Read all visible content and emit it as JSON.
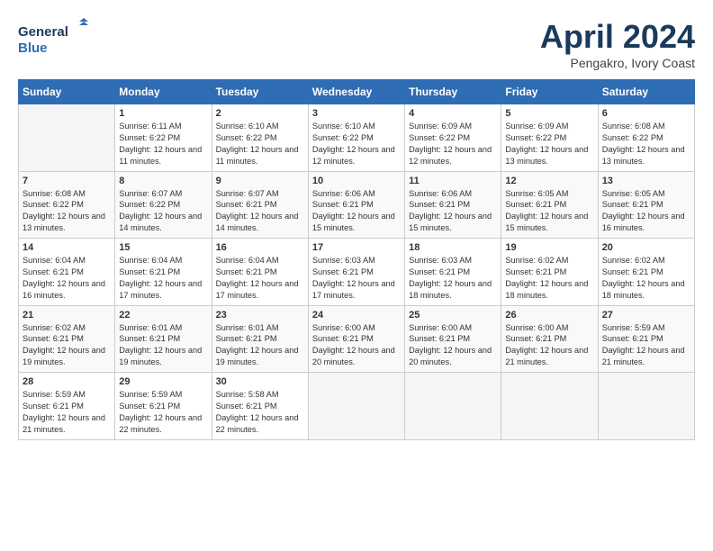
{
  "header": {
    "logo_line1": "General",
    "logo_line2": "Blue",
    "month": "April 2024",
    "location": "Pengakro, Ivory Coast"
  },
  "days_of_week": [
    "Sunday",
    "Monday",
    "Tuesday",
    "Wednesday",
    "Thursday",
    "Friday",
    "Saturday"
  ],
  "weeks": [
    [
      {
        "day": "",
        "sunrise": "",
        "sunset": "",
        "daylight": ""
      },
      {
        "day": "1",
        "sunrise": "Sunrise: 6:11 AM",
        "sunset": "Sunset: 6:22 PM",
        "daylight": "Daylight: 12 hours and 11 minutes."
      },
      {
        "day": "2",
        "sunrise": "Sunrise: 6:10 AM",
        "sunset": "Sunset: 6:22 PM",
        "daylight": "Daylight: 12 hours and 11 minutes."
      },
      {
        "day": "3",
        "sunrise": "Sunrise: 6:10 AM",
        "sunset": "Sunset: 6:22 PM",
        "daylight": "Daylight: 12 hours and 12 minutes."
      },
      {
        "day": "4",
        "sunrise": "Sunrise: 6:09 AM",
        "sunset": "Sunset: 6:22 PM",
        "daylight": "Daylight: 12 hours and 12 minutes."
      },
      {
        "day": "5",
        "sunrise": "Sunrise: 6:09 AM",
        "sunset": "Sunset: 6:22 PM",
        "daylight": "Daylight: 12 hours and 13 minutes."
      },
      {
        "day": "6",
        "sunrise": "Sunrise: 6:08 AM",
        "sunset": "Sunset: 6:22 PM",
        "daylight": "Daylight: 12 hours and 13 minutes."
      }
    ],
    [
      {
        "day": "7",
        "sunrise": "Sunrise: 6:08 AM",
        "sunset": "Sunset: 6:22 PM",
        "daylight": "Daylight: 12 hours and 13 minutes."
      },
      {
        "day": "8",
        "sunrise": "Sunrise: 6:07 AM",
        "sunset": "Sunset: 6:22 PM",
        "daylight": "Daylight: 12 hours and 14 minutes."
      },
      {
        "day": "9",
        "sunrise": "Sunrise: 6:07 AM",
        "sunset": "Sunset: 6:21 PM",
        "daylight": "Daylight: 12 hours and 14 minutes."
      },
      {
        "day": "10",
        "sunrise": "Sunrise: 6:06 AM",
        "sunset": "Sunset: 6:21 PM",
        "daylight": "Daylight: 12 hours and 15 minutes."
      },
      {
        "day": "11",
        "sunrise": "Sunrise: 6:06 AM",
        "sunset": "Sunset: 6:21 PM",
        "daylight": "Daylight: 12 hours and 15 minutes."
      },
      {
        "day": "12",
        "sunrise": "Sunrise: 6:05 AM",
        "sunset": "Sunset: 6:21 PM",
        "daylight": "Daylight: 12 hours and 15 minutes."
      },
      {
        "day": "13",
        "sunrise": "Sunrise: 6:05 AM",
        "sunset": "Sunset: 6:21 PM",
        "daylight": "Daylight: 12 hours and 16 minutes."
      }
    ],
    [
      {
        "day": "14",
        "sunrise": "Sunrise: 6:04 AM",
        "sunset": "Sunset: 6:21 PM",
        "daylight": "Daylight: 12 hours and 16 minutes."
      },
      {
        "day": "15",
        "sunrise": "Sunrise: 6:04 AM",
        "sunset": "Sunset: 6:21 PM",
        "daylight": "Daylight: 12 hours and 17 minutes."
      },
      {
        "day": "16",
        "sunrise": "Sunrise: 6:04 AM",
        "sunset": "Sunset: 6:21 PM",
        "daylight": "Daylight: 12 hours and 17 minutes."
      },
      {
        "day": "17",
        "sunrise": "Sunrise: 6:03 AM",
        "sunset": "Sunset: 6:21 PM",
        "daylight": "Daylight: 12 hours and 17 minutes."
      },
      {
        "day": "18",
        "sunrise": "Sunrise: 6:03 AM",
        "sunset": "Sunset: 6:21 PM",
        "daylight": "Daylight: 12 hours and 18 minutes."
      },
      {
        "day": "19",
        "sunrise": "Sunrise: 6:02 AM",
        "sunset": "Sunset: 6:21 PM",
        "daylight": "Daylight: 12 hours and 18 minutes."
      },
      {
        "day": "20",
        "sunrise": "Sunrise: 6:02 AM",
        "sunset": "Sunset: 6:21 PM",
        "daylight": "Daylight: 12 hours and 18 minutes."
      }
    ],
    [
      {
        "day": "21",
        "sunrise": "Sunrise: 6:02 AM",
        "sunset": "Sunset: 6:21 PM",
        "daylight": "Daylight: 12 hours and 19 minutes."
      },
      {
        "day": "22",
        "sunrise": "Sunrise: 6:01 AM",
        "sunset": "Sunset: 6:21 PM",
        "daylight": "Daylight: 12 hours and 19 minutes."
      },
      {
        "day": "23",
        "sunrise": "Sunrise: 6:01 AM",
        "sunset": "Sunset: 6:21 PM",
        "daylight": "Daylight: 12 hours and 19 minutes."
      },
      {
        "day": "24",
        "sunrise": "Sunrise: 6:00 AM",
        "sunset": "Sunset: 6:21 PM",
        "daylight": "Daylight: 12 hours and 20 minutes."
      },
      {
        "day": "25",
        "sunrise": "Sunrise: 6:00 AM",
        "sunset": "Sunset: 6:21 PM",
        "daylight": "Daylight: 12 hours and 20 minutes."
      },
      {
        "day": "26",
        "sunrise": "Sunrise: 6:00 AM",
        "sunset": "Sunset: 6:21 PM",
        "daylight": "Daylight: 12 hours and 21 minutes."
      },
      {
        "day": "27",
        "sunrise": "Sunrise: 5:59 AM",
        "sunset": "Sunset: 6:21 PM",
        "daylight": "Daylight: 12 hours and 21 minutes."
      }
    ],
    [
      {
        "day": "28",
        "sunrise": "Sunrise: 5:59 AM",
        "sunset": "Sunset: 6:21 PM",
        "daylight": "Daylight: 12 hours and 21 minutes."
      },
      {
        "day": "29",
        "sunrise": "Sunrise: 5:59 AM",
        "sunset": "Sunset: 6:21 PM",
        "daylight": "Daylight: 12 hours and 22 minutes."
      },
      {
        "day": "30",
        "sunrise": "Sunrise: 5:58 AM",
        "sunset": "Sunset: 6:21 PM",
        "daylight": "Daylight: 12 hours and 22 minutes."
      },
      {
        "day": "",
        "sunrise": "",
        "sunset": "",
        "daylight": ""
      },
      {
        "day": "",
        "sunrise": "",
        "sunset": "",
        "daylight": ""
      },
      {
        "day": "",
        "sunrise": "",
        "sunset": "",
        "daylight": ""
      },
      {
        "day": "",
        "sunrise": "",
        "sunset": "",
        "daylight": ""
      }
    ]
  ]
}
